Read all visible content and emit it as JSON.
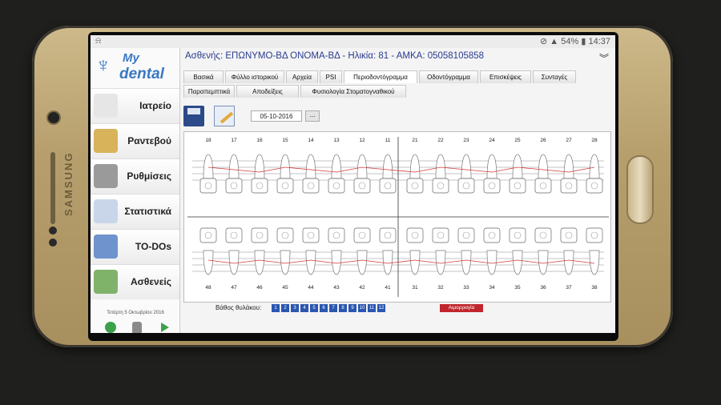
{
  "device": {
    "brand": "SAMSUNG"
  },
  "statusbar": {
    "battery": "54%",
    "time": "14:37",
    "left_icon": "a-icon"
  },
  "sidebar": {
    "logo": {
      "my": "My",
      "dental": "dental"
    },
    "items": [
      {
        "label": "Ιατρείο",
        "icon": "chair-icon",
        "color": "#e6e6e6"
      },
      {
        "label": "Ραντεβού",
        "icon": "book-icon",
        "color": "#d9b35a"
      },
      {
        "label": "Ρυθμίσεις",
        "icon": "tools-icon",
        "color": "#9a9a9a"
      },
      {
        "label": "Στατιστικά",
        "icon": "chart-icon",
        "color": "#c9d6ea"
      },
      {
        "label": "TO-DOs",
        "icon": "todo-icon",
        "color": "#6f93cc"
      },
      {
        "label": "Ασθενείς",
        "icon": "people-icon",
        "color": "#7fb36a"
      }
    ],
    "date": "Τετάρτη 5 Οκτωβρίου 2016"
  },
  "header": {
    "patient": "Ασθενής: ΕΠΩΝΥΜΟ-ΒΔ ΟΝΟΜΑ-ΒΔ - Ηλικία: 81 - ΑΜΚΑ: 05058105858"
  },
  "tabs_row1": [
    "Βασικά",
    "Φύλλο ιστορικού",
    "Αρχεία",
    "PSI",
    "Περιοδοντόγραμμα",
    "Οδοντόγραμμα",
    "Επισκέψεις",
    "Συνταγές"
  ],
  "tabs_row2": [
    "Παραπεμπτικά",
    "Αποδείξεις",
    "Φυσιολογία Στοματογναθικού"
  ],
  "active_tab": "Περιοδοντόγραμμα",
  "toolbar": {
    "date": "05-10-2016",
    "date_button": "..."
  },
  "chart": {
    "upper_teeth": [
      "18",
      "17",
      "16",
      "15",
      "14",
      "13",
      "12",
      "11",
      "21",
      "22",
      "23",
      "24",
      "25",
      "26",
      "27",
      "28"
    ],
    "lower_teeth": [
      "48",
      "47",
      "46",
      "45",
      "44",
      "43",
      "42",
      "41",
      "31",
      "32",
      "33",
      "34",
      "35",
      "36",
      "37",
      "38"
    ]
  },
  "footer": {
    "depth_label": "Βάθος θυλάκου:",
    "depths": [
      "1",
      "2",
      "3",
      "4",
      "5",
      "6",
      "7",
      "8",
      "9",
      "10",
      "11",
      "12"
    ],
    "bleeding": "Αιμορραγία"
  }
}
